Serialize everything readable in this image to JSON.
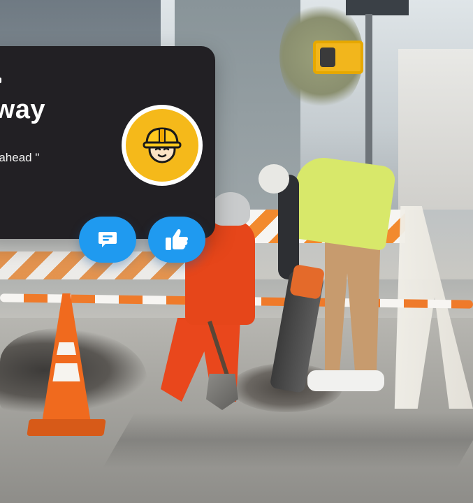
{
  "notification": {
    "title": "away",
    "message": "ted ahead \"",
    "sender": "ert",
    "avatar_icon": "construction-worker-icon",
    "background": "#222024"
  },
  "actions": [
    {
      "icon": "comment-icon",
      "color": "#1f9af0"
    },
    {
      "icon": "thumbs-up-icon",
      "color": "#1f9af0"
    }
  ],
  "colors": {
    "accent": "#1f9af0",
    "avatar_bg": "#f5b91a"
  }
}
